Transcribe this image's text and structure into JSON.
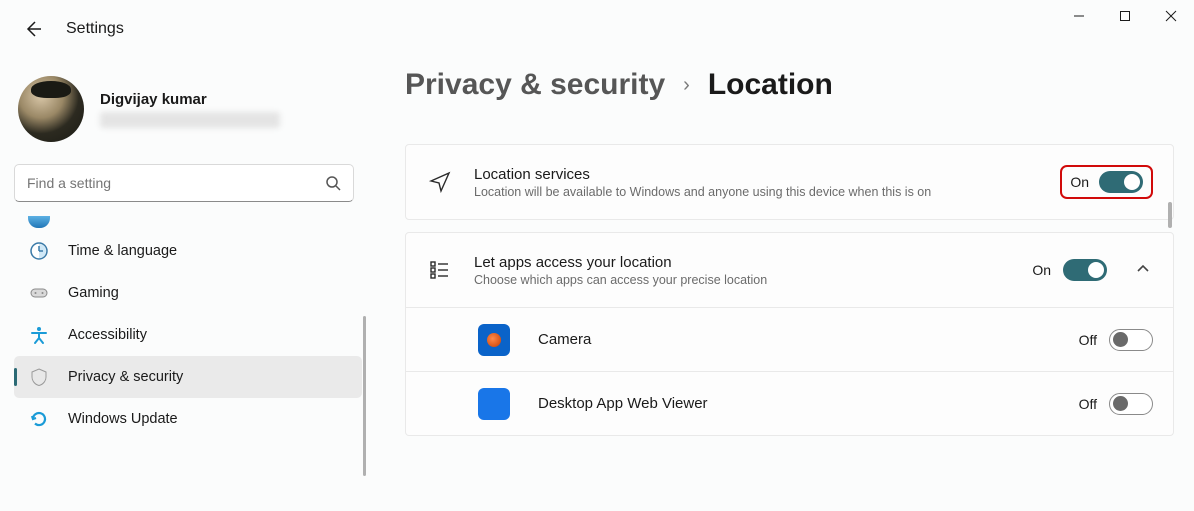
{
  "app_title": "Settings",
  "user": {
    "name": "Digvijay kumar"
  },
  "search": {
    "placeholder": "Find a setting"
  },
  "sidebar": {
    "items": [
      {
        "label": ""
      },
      {
        "label": "Time & language"
      },
      {
        "label": "Gaming"
      },
      {
        "label": "Accessibility"
      },
      {
        "label": "Privacy & security",
        "selected": true
      },
      {
        "label": "Windows Update"
      }
    ]
  },
  "breadcrumb": {
    "parent": "Privacy & security",
    "current": "Location"
  },
  "settings": {
    "location_services": {
      "title": "Location services",
      "description": "Location will be available to Windows and anyone using this device when this is on",
      "state_label": "On",
      "state": true
    },
    "apps_access": {
      "title": "Let apps access your location",
      "description": "Choose which apps can access your precise location",
      "state_label": "On",
      "state": true,
      "expanded": true,
      "apps": [
        {
          "name": "Camera",
          "state_label": "Off",
          "state": false,
          "icon": "camera"
        },
        {
          "name": "Desktop App Web Viewer",
          "state_label": "Off",
          "state": false,
          "icon": "generic"
        }
      ]
    }
  }
}
